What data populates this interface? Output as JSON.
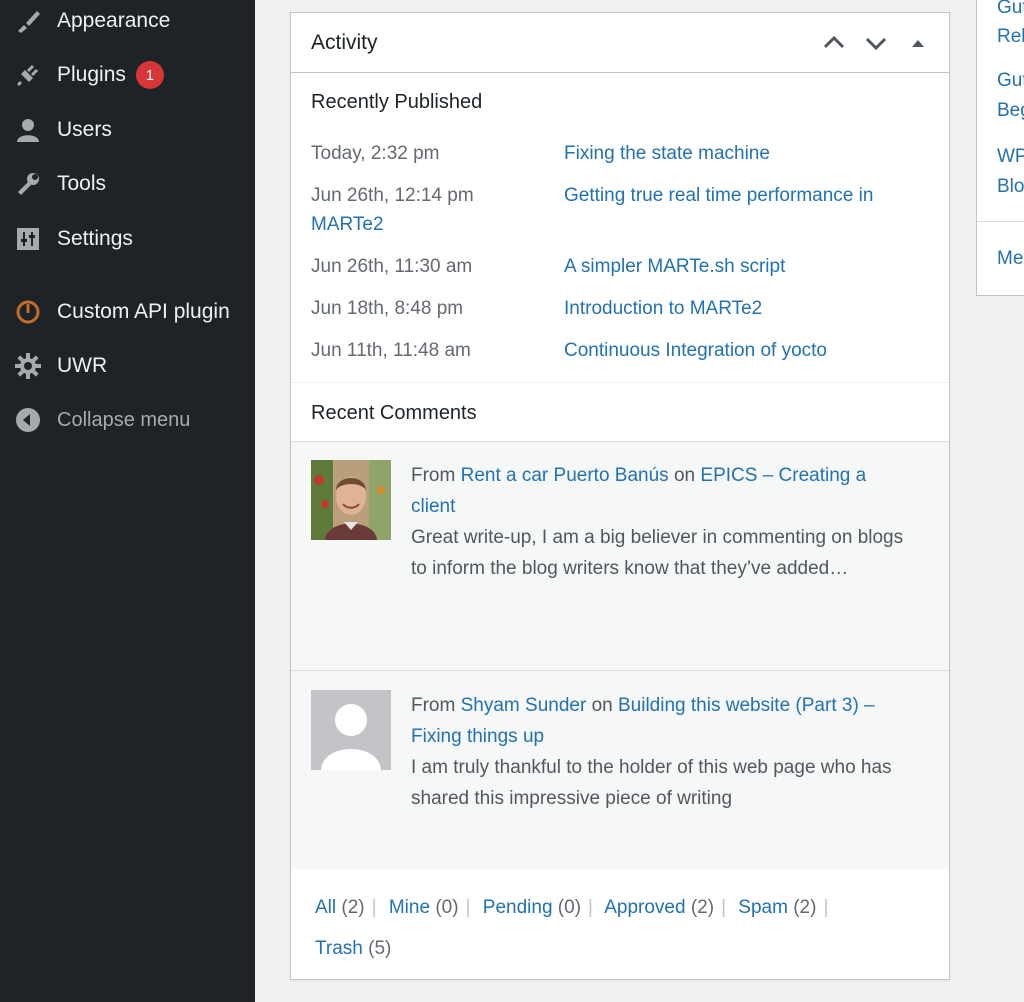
{
  "sidebar": {
    "items": [
      {
        "label": "Appearance",
        "icon": "paintbrush-icon"
      },
      {
        "label": "Plugins",
        "icon": "plugin-icon",
        "badge": "1"
      },
      {
        "label": "Users",
        "icon": "users-icon"
      },
      {
        "label": "Tools",
        "icon": "wrench-icon"
      },
      {
        "label": "Settings",
        "icon": "settings-icon"
      },
      {
        "label": "Custom API plugin",
        "icon": "custom-api-icon"
      },
      {
        "label": "UWR",
        "icon": "gear-icon"
      }
    ],
    "collapse_label": "Collapse menu"
  },
  "activity": {
    "title": "Activity",
    "recently_published": {
      "title": "Recently Published",
      "posts": [
        {
          "date": "Today, 2:32 pm",
          "title": "Fixing the state machine"
        },
        {
          "date": "Jun 26th, 12:14 pm",
          "title": "Getting true real time performance in",
          "title_cont": "MARTe2"
        },
        {
          "date": "Jun 26th, 11:30 am",
          "title": "A simpler MARTe.sh script"
        },
        {
          "date": "Jun 18th, 8:48 pm",
          "title": "Introduction to MARTe2"
        },
        {
          "date": "Jun 11th, 11:48 am",
          "title": "Continuous Integration of yocto"
        }
      ]
    },
    "recent_comments": {
      "title": "Recent Comments",
      "comments": [
        {
          "from": "From",
          "author": "Rent a car Puerto Banús",
          "on": "on",
          "post": "EPICS – Creating a client",
          "text": "Great write-up, I am a big believer in commenting on blogs to inform the blog writers know that they’ve added…"
        },
        {
          "from": "From",
          "author": "Shyam Sunder",
          "on": "on",
          "post": "Building this website (Part 3) – Fixing things up",
          "text": "I am truly thankful to the holder of this web page who has shared this impressive piece of writing"
        }
      ]
    },
    "filters": [
      {
        "label": "All",
        "count": "(2)"
      },
      {
        "label": "Mine",
        "count": "(0)"
      },
      {
        "label": "Pending",
        "count": "(0)"
      },
      {
        "label": "Approved",
        "count": "(2)"
      },
      {
        "label": "Spam",
        "count": "(2)"
      },
      {
        "label": "Trash",
        "count": "(5)"
      }
    ]
  },
  "right_widget": {
    "lines": [
      "Gut",
      "Rel",
      "Gut",
      "Beg",
      "WP",
      "Blo",
      "Me"
    ]
  },
  "colors": {
    "sidebar_bg": "#1d2327",
    "link": "#2271b1",
    "badge": "#d63638",
    "page_bg": "#f0f0f1"
  }
}
